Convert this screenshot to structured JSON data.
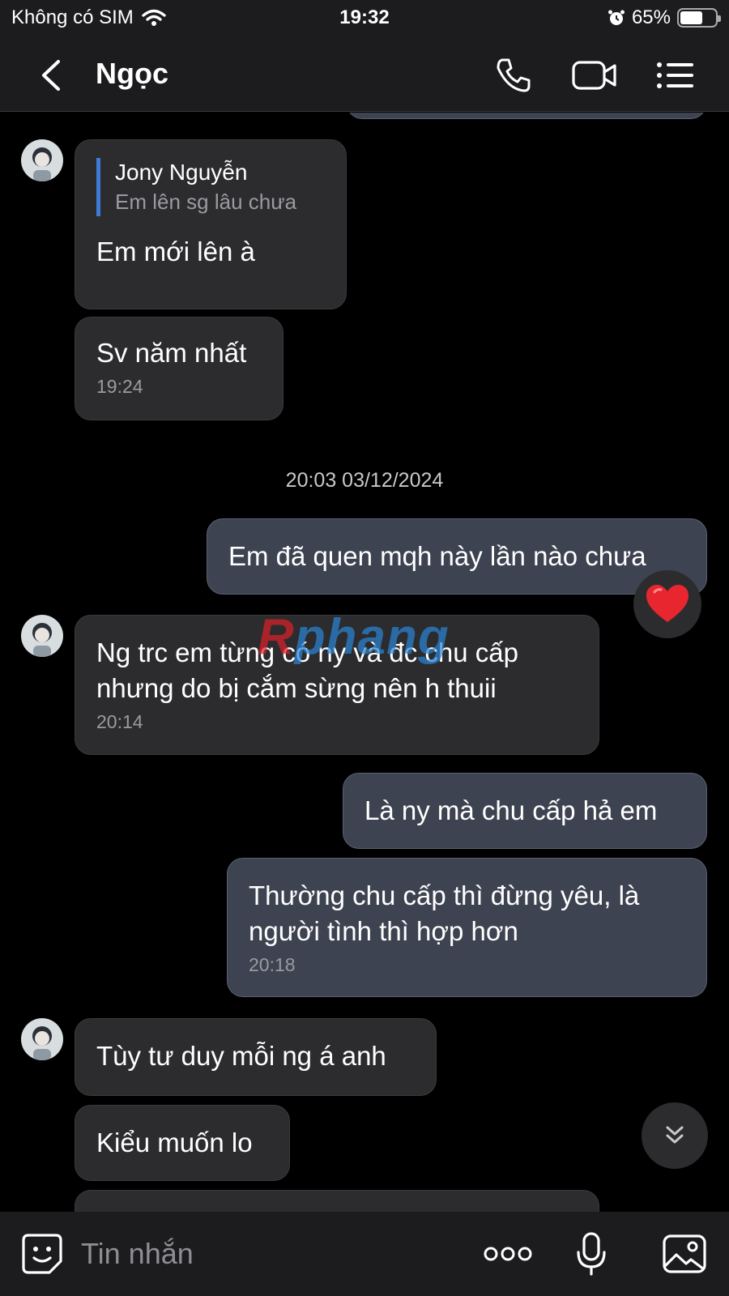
{
  "status_bar": {
    "carrier": "Không có SIM",
    "time": "19:32",
    "battery": "65%",
    "battery_level": 0.65
  },
  "header": {
    "contact_name": "Ngọc"
  },
  "messages": [
    {
      "side": "in",
      "quote_name": "Jony Nguyễn",
      "quote_text": "Em lên sg lâu chưa",
      "text": "Em mới lên à"
    },
    {
      "side": "in",
      "text": "Sv năm nhất",
      "time": "19:24"
    },
    {
      "side": "out",
      "text": "Em đã quen mqh này lần nào chưa",
      "reaction": "heart"
    },
    {
      "side": "in",
      "text": "Ng trc em từng có ny và đc chu cấp nhưng do bị cắm sừng nên h thuii",
      "time": "20:14"
    },
    {
      "side": "out",
      "text": "Là ny mà chu cấp hả em"
    },
    {
      "side": "out",
      "text": "Thường chu cấp thì đừng yêu, là người tình thì hợp hơn",
      "time": "20:18"
    },
    {
      "side": "in",
      "text": "Tùy tư duy mỗi ng á anh"
    },
    {
      "side": "in",
      "text": "Kiểu muốn lo"
    }
  ],
  "date_separator": "20:03 03/12/2024",
  "watermark": {
    "first": "R",
    "rest": "phang"
  },
  "input_bar": {
    "placeholder": "Tin nhắn"
  },
  "colors": {
    "incoming_bubble": "#2c2c2e",
    "outgoing_bubble": "#3d4350",
    "quote_bar": "#3e7bd6",
    "background": "#000000"
  }
}
